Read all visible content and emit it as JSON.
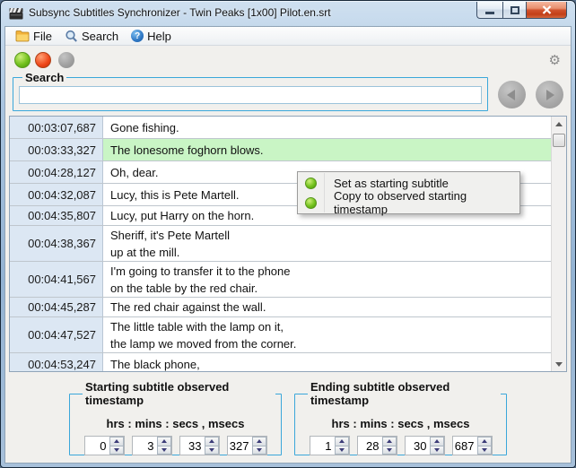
{
  "window": {
    "title": "Subsync Subtitles Synchronizer - Twin Peaks [1x00] Pilot.en.srt"
  },
  "menubar": {
    "file": "File",
    "search": "Search",
    "help": "Help"
  },
  "icons": {
    "gear": "⚙",
    "help_glyph": "?"
  },
  "search_box": {
    "legend": "Search",
    "value": ""
  },
  "subtitles": [
    {
      "time": "00:03:07,687",
      "text": "Gone fishing."
    },
    {
      "time": "00:03:33,327",
      "text": "The lonesome foghorn blows."
    },
    {
      "time": "00:04:28,127",
      "text": "Oh, dear."
    },
    {
      "time": "00:04:32,087",
      "text": "Lucy, this is Pete Martell."
    },
    {
      "time": "00:04:35,807",
      "text": "Lucy, put Harry on the horn."
    },
    {
      "time": "00:04:38,367",
      "text": "Sheriff, it's Pete Martell\nup at the mill."
    },
    {
      "time": "00:04:41,567",
      "text": "I'm going to transfer it to the phone\non the table by the red chair."
    },
    {
      "time": "00:04:45,287",
      "text": "The red chair against the wall."
    },
    {
      "time": "00:04:47,527",
      "text": "The little table with the lamp on it,\nthe lamp we moved from the corner."
    },
    {
      "time": "00:04:53,247",
      "text": "The black phone,"
    }
  ],
  "highlighted_row_time": "00:03:33,327",
  "context_menu": {
    "items": [
      "Set as starting subtitle",
      "Copy to observed starting timestamp"
    ]
  },
  "timestamps": {
    "starting": {
      "legend": "Starting subtitle observed timestamp",
      "units": "hrs : mins : secs , msecs",
      "hrs": "0",
      "mins": "3",
      "secs": "33",
      "msecs": "327"
    },
    "ending": {
      "legend": "Ending subtitle observed timestamp",
      "units": "hrs : mins : secs , msecs",
      "hrs": "1",
      "mins": "28",
      "secs": "30",
      "msecs": "687"
    }
  },
  "colors": {
    "accent_blue": "#3aa7da",
    "highlight_green": "#c9f5c5",
    "timestamp_column_bg": "#dce7f3",
    "close_button_red": "#c23f18",
    "status_ball_green": "#74c21e",
    "status_ball_red": "#ee4517"
  }
}
